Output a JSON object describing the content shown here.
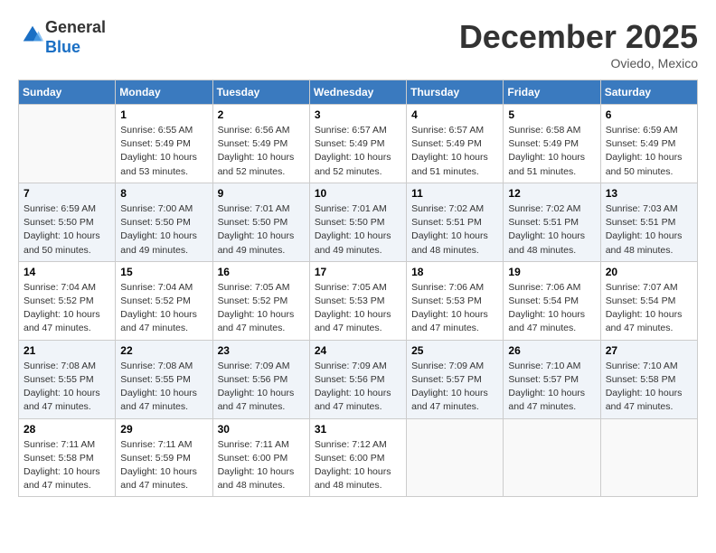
{
  "header": {
    "logo_line1": "General",
    "logo_line2": "Blue",
    "month": "December 2025",
    "location": "Oviedo, Mexico"
  },
  "weekdays": [
    "Sunday",
    "Monday",
    "Tuesday",
    "Wednesday",
    "Thursday",
    "Friday",
    "Saturday"
  ],
  "weeks": [
    [
      {
        "day": "",
        "sunrise": "",
        "sunset": "",
        "daylight": ""
      },
      {
        "day": "1",
        "sunrise": "Sunrise: 6:55 AM",
        "sunset": "Sunset: 5:49 PM",
        "daylight": "Daylight: 10 hours and 53 minutes."
      },
      {
        "day": "2",
        "sunrise": "Sunrise: 6:56 AM",
        "sunset": "Sunset: 5:49 PM",
        "daylight": "Daylight: 10 hours and 52 minutes."
      },
      {
        "day": "3",
        "sunrise": "Sunrise: 6:57 AM",
        "sunset": "Sunset: 5:49 PM",
        "daylight": "Daylight: 10 hours and 52 minutes."
      },
      {
        "day": "4",
        "sunrise": "Sunrise: 6:57 AM",
        "sunset": "Sunset: 5:49 PM",
        "daylight": "Daylight: 10 hours and 51 minutes."
      },
      {
        "day": "5",
        "sunrise": "Sunrise: 6:58 AM",
        "sunset": "Sunset: 5:49 PM",
        "daylight": "Daylight: 10 hours and 51 minutes."
      },
      {
        "day": "6",
        "sunrise": "Sunrise: 6:59 AM",
        "sunset": "Sunset: 5:49 PM",
        "daylight": "Daylight: 10 hours and 50 minutes."
      }
    ],
    [
      {
        "day": "7",
        "sunrise": "Sunrise: 6:59 AM",
        "sunset": "Sunset: 5:50 PM",
        "daylight": "Daylight: 10 hours and 50 minutes."
      },
      {
        "day": "8",
        "sunrise": "Sunrise: 7:00 AM",
        "sunset": "Sunset: 5:50 PM",
        "daylight": "Daylight: 10 hours and 49 minutes."
      },
      {
        "day": "9",
        "sunrise": "Sunrise: 7:01 AM",
        "sunset": "Sunset: 5:50 PM",
        "daylight": "Daylight: 10 hours and 49 minutes."
      },
      {
        "day": "10",
        "sunrise": "Sunrise: 7:01 AM",
        "sunset": "Sunset: 5:50 PM",
        "daylight": "Daylight: 10 hours and 49 minutes."
      },
      {
        "day": "11",
        "sunrise": "Sunrise: 7:02 AM",
        "sunset": "Sunset: 5:51 PM",
        "daylight": "Daylight: 10 hours and 48 minutes."
      },
      {
        "day": "12",
        "sunrise": "Sunrise: 7:02 AM",
        "sunset": "Sunset: 5:51 PM",
        "daylight": "Daylight: 10 hours and 48 minutes."
      },
      {
        "day": "13",
        "sunrise": "Sunrise: 7:03 AM",
        "sunset": "Sunset: 5:51 PM",
        "daylight": "Daylight: 10 hours and 48 minutes."
      }
    ],
    [
      {
        "day": "14",
        "sunrise": "Sunrise: 7:04 AM",
        "sunset": "Sunset: 5:52 PM",
        "daylight": "Daylight: 10 hours and 47 minutes."
      },
      {
        "day": "15",
        "sunrise": "Sunrise: 7:04 AM",
        "sunset": "Sunset: 5:52 PM",
        "daylight": "Daylight: 10 hours and 47 minutes."
      },
      {
        "day": "16",
        "sunrise": "Sunrise: 7:05 AM",
        "sunset": "Sunset: 5:52 PM",
        "daylight": "Daylight: 10 hours and 47 minutes."
      },
      {
        "day": "17",
        "sunrise": "Sunrise: 7:05 AM",
        "sunset": "Sunset: 5:53 PM",
        "daylight": "Daylight: 10 hours and 47 minutes."
      },
      {
        "day": "18",
        "sunrise": "Sunrise: 7:06 AM",
        "sunset": "Sunset: 5:53 PM",
        "daylight": "Daylight: 10 hours and 47 minutes."
      },
      {
        "day": "19",
        "sunrise": "Sunrise: 7:06 AM",
        "sunset": "Sunset: 5:54 PM",
        "daylight": "Daylight: 10 hours and 47 minutes."
      },
      {
        "day": "20",
        "sunrise": "Sunrise: 7:07 AM",
        "sunset": "Sunset: 5:54 PM",
        "daylight": "Daylight: 10 hours and 47 minutes."
      }
    ],
    [
      {
        "day": "21",
        "sunrise": "Sunrise: 7:08 AM",
        "sunset": "Sunset: 5:55 PM",
        "daylight": "Daylight: 10 hours and 47 minutes."
      },
      {
        "day": "22",
        "sunrise": "Sunrise: 7:08 AM",
        "sunset": "Sunset: 5:55 PM",
        "daylight": "Daylight: 10 hours and 47 minutes."
      },
      {
        "day": "23",
        "sunrise": "Sunrise: 7:09 AM",
        "sunset": "Sunset: 5:56 PM",
        "daylight": "Daylight: 10 hours and 47 minutes."
      },
      {
        "day": "24",
        "sunrise": "Sunrise: 7:09 AM",
        "sunset": "Sunset: 5:56 PM",
        "daylight": "Daylight: 10 hours and 47 minutes."
      },
      {
        "day": "25",
        "sunrise": "Sunrise: 7:09 AM",
        "sunset": "Sunset: 5:57 PM",
        "daylight": "Daylight: 10 hours and 47 minutes."
      },
      {
        "day": "26",
        "sunrise": "Sunrise: 7:10 AM",
        "sunset": "Sunset: 5:57 PM",
        "daylight": "Daylight: 10 hours and 47 minutes."
      },
      {
        "day": "27",
        "sunrise": "Sunrise: 7:10 AM",
        "sunset": "Sunset: 5:58 PM",
        "daylight": "Daylight: 10 hours and 47 minutes."
      }
    ],
    [
      {
        "day": "28",
        "sunrise": "Sunrise: 7:11 AM",
        "sunset": "Sunset: 5:58 PM",
        "daylight": "Daylight: 10 hours and 47 minutes."
      },
      {
        "day": "29",
        "sunrise": "Sunrise: 7:11 AM",
        "sunset": "Sunset: 5:59 PM",
        "daylight": "Daylight: 10 hours and 47 minutes."
      },
      {
        "day": "30",
        "sunrise": "Sunrise: 7:11 AM",
        "sunset": "Sunset: 6:00 PM",
        "daylight": "Daylight: 10 hours and 48 minutes."
      },
      {
        "day": "31",
        "sunrise": "Sunrise: 7:12 AM",
        "sunset": "Sunset: 6:00 PM",
        "daylight": "Daylight: 10 hours and 48 minutes."
      },
      {
        "day": "",
        "sunrise": "",
        "sunset": "",
        "daylight": ""
      },
      {
        "day": "",
        "sunrise": "",
        "sunset": "",
        "daylight": ""
      },
      {
        "day": "",
        "sunrise": "",
        "sunset": "",
        "daylight": ""
      }
    ]
  ]
}
